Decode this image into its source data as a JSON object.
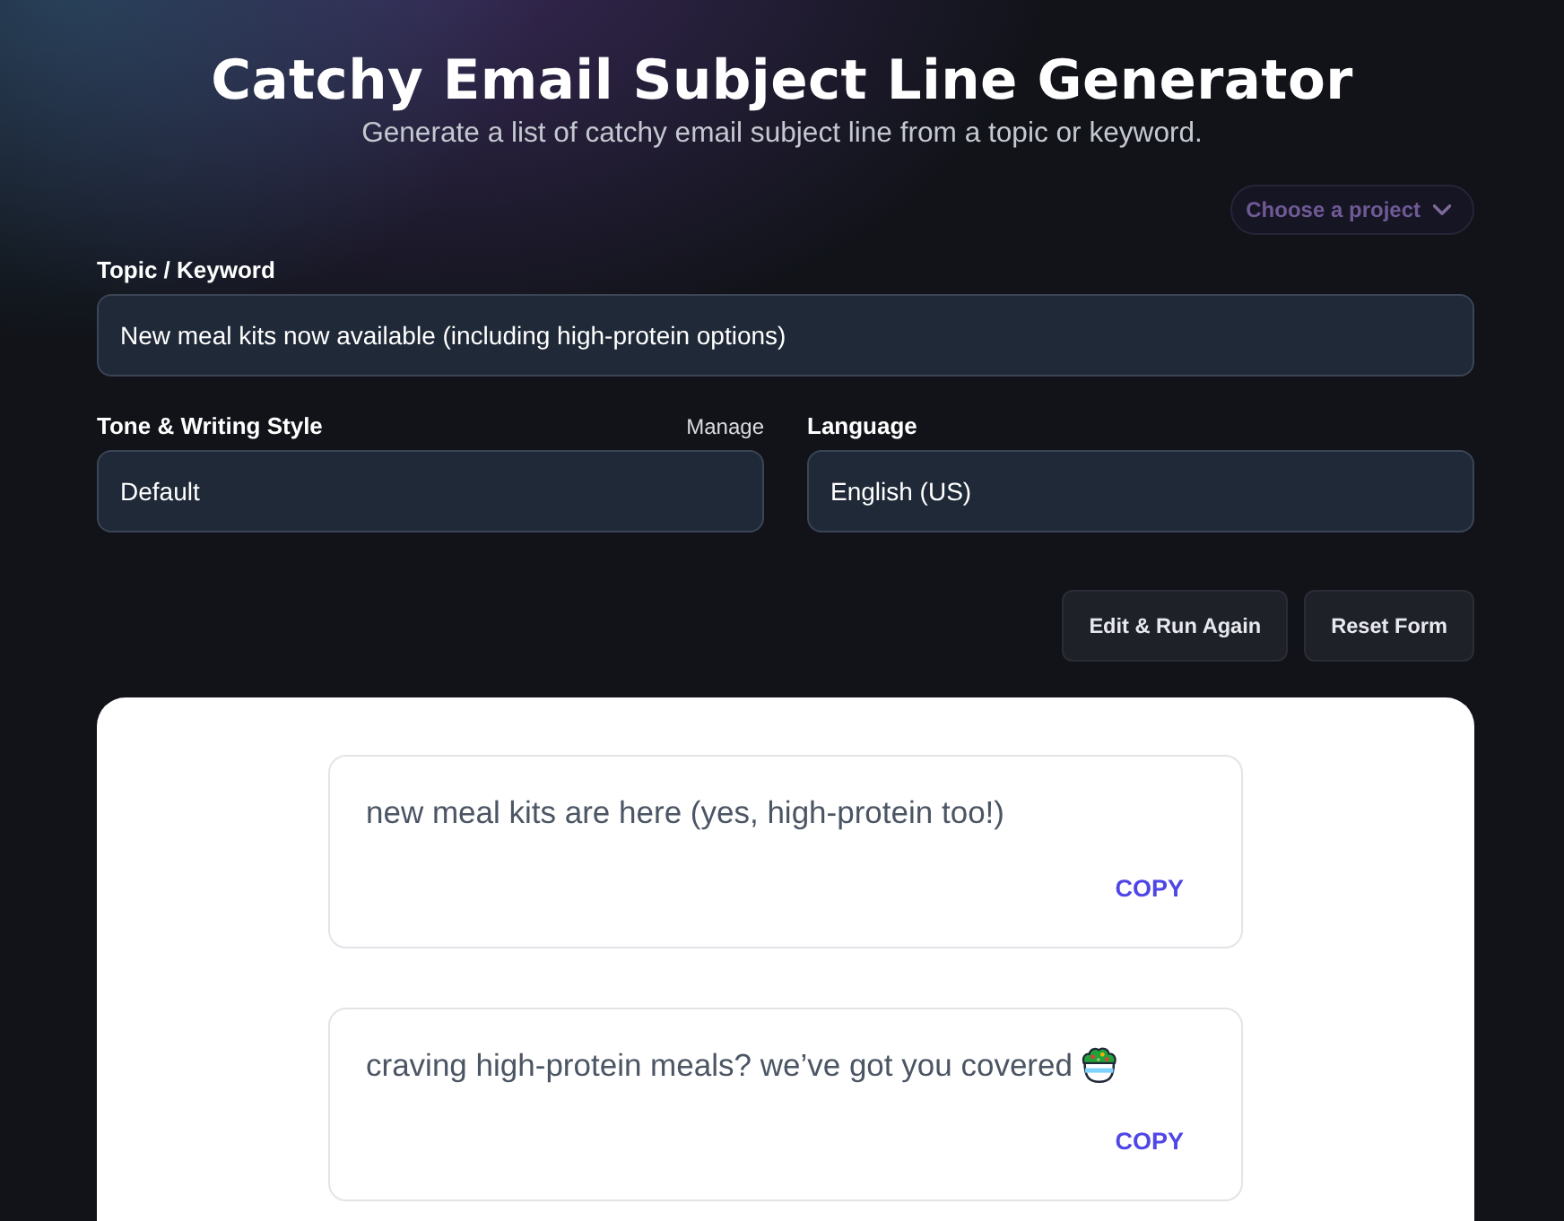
{
  "header": {
    "title": "Catchy Email Subject Line Generator",
    "subtitle": "Generate a list of catchy email subject line from a topic or keyword."
  },
  "project_picker": {
    "label": "Choose a project"
  },
  "form": {
    "topic": {
      "label": "Topic / Keyword",
      "value": "New meal kits now available (including high-protein options)"
    },
    "tone": {
      "label": "Tone & Writing Style",
      "link": "Manage",
      "value": "Default"
    },
    "language": {
      "label": "Language",
      "value": "English (US)"
    }
  },
  "actions": [
    "Edit & Run Again",
    "Reset Form"
  ],
  "results": [
    {
      "kind": "text",
      "text": "new meal kits are here (yes, high-protein too!)",
      "copy_label": "COPY"
    },
    {
      "kind": "text-with-emoji",
      "text": "craving high-protein meals? we’ve got you covered",
      "copy_label": "COPY"
    }
  ]
}
